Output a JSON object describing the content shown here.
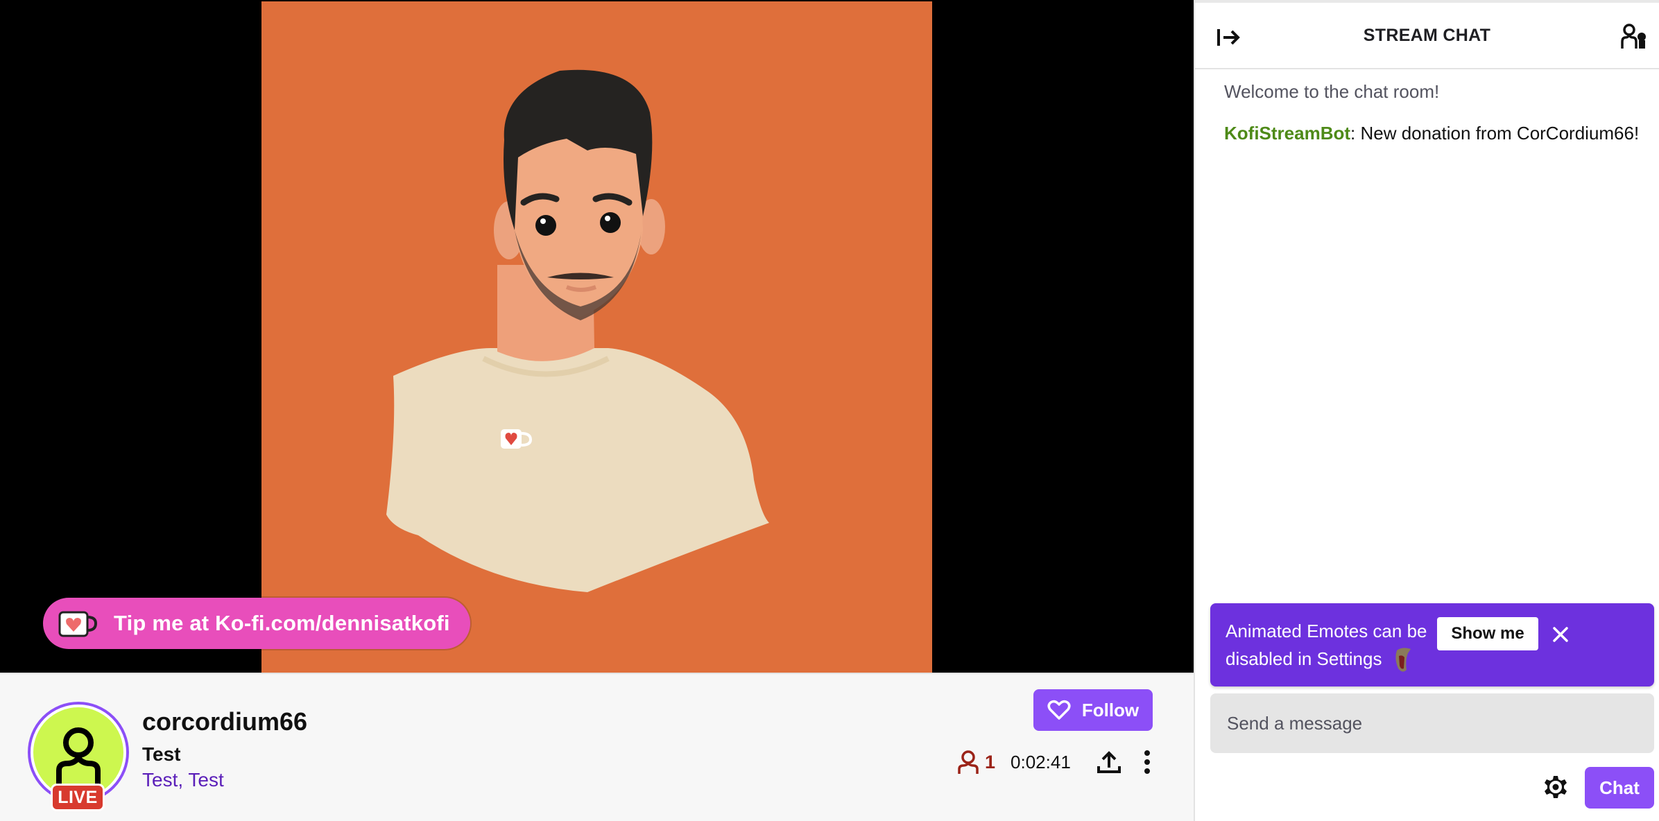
{
  "video": {
    "overlay_text": "Tip me at Ko-fi.com/dennisatkofi",
    "colors": {
      "background": "#df6f3b",
      "letterbox": "#000000",
      "tip_pill": "#e84ebb"
    }
  },
  "channel": {
    "name": "corcordium66",
    "stream_title": "Test",
    "tags": "Test, Test",
    "live_badge": "LIVE",
    "follow_label": "Follow",
    "viewer_count": "1",
    "uptime": "0:02:41",
    "colors": {
      "avatar_bg": "#cdf74f",
      "accent": "#8c4ff7",
      "live": "#d83a2e",
      "viewer": "#9b2318"
    }
  },
  "chat": {
    "title": "STREAM CHAT",
    "welcome": "Welcome to the chat room!",
    "messages": [
      {
        "author": "KofiStreamBot",
        "separator": ": ",
        "text": "New donation from CorCordium66!",
        "author_color": "#4e8a18"
      }
    ],
    "banner": {
      "text": "Animated Emotes can be disabled in Settings",
      "button_label": "Show me",
      "background": "#6d31de"
    },
    "input_placeholder": "Send a message",
    "send_label": "Chat"
  },
  "icons": {
    "collapse": "arrow-right-from-bar-icon",
    "users": "community-users-icon",
    "close": "close-x-icon",
    "settings": "gear-icon",
    "share": "share-upload-icon",
    "more": "more-vertical-icon",
    "viewer": "person-outline-icon",
    "follow": "heart-outline-icon"
  }
}
